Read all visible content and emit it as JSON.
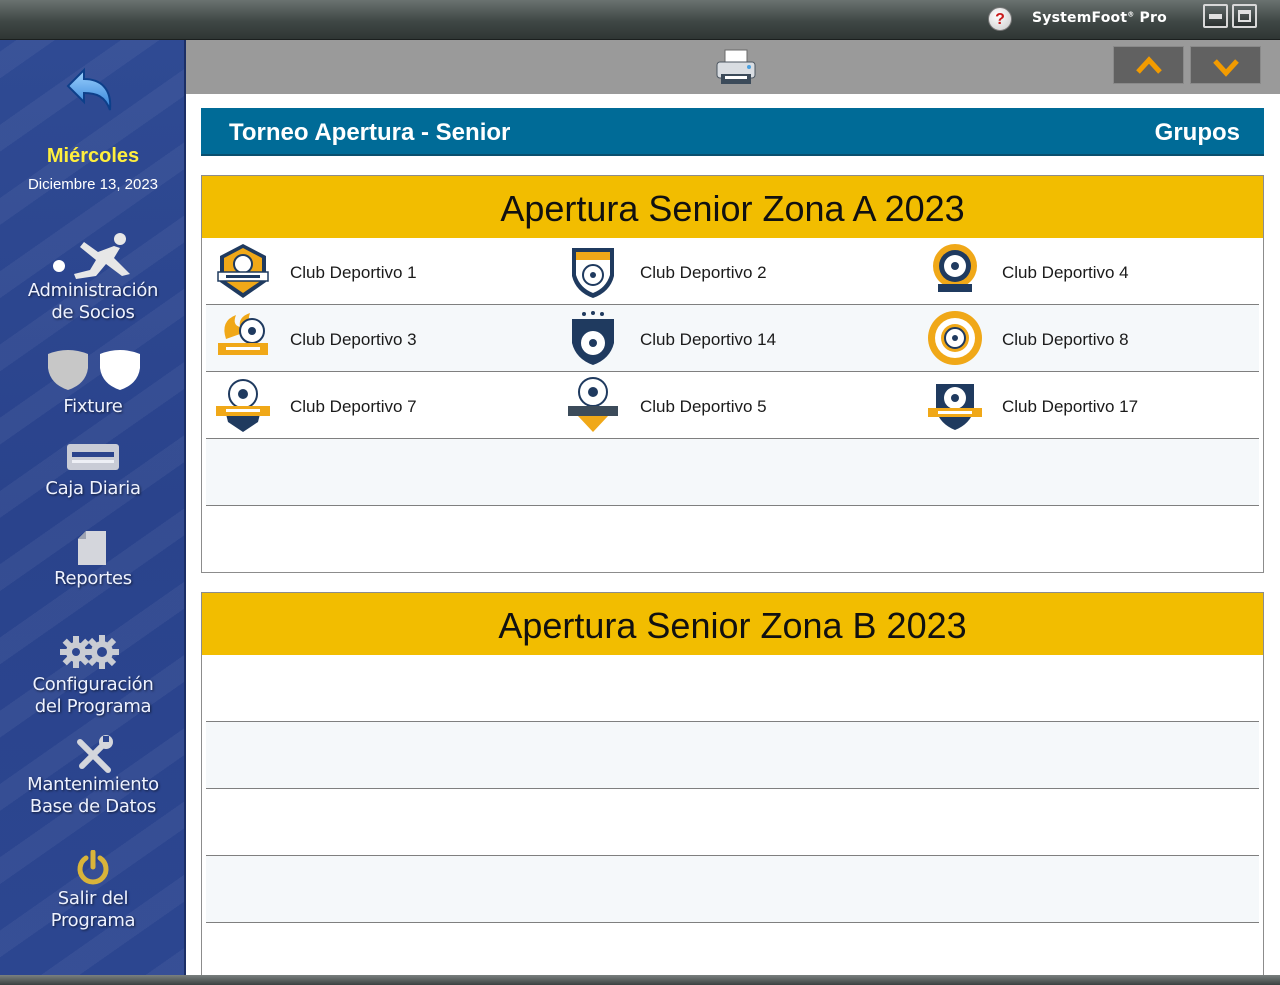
{
  "titlebar": {
    "help_label": "?",
    "brand_name": "SystemFoot",
    "brand_mark": "®",
    "brand_suffix": " Pro"
  },
  "sidebar": {
    "day": "Miércoles",
    "date": "Diciembre 13, 2023",
    "items": [
      {
        "icon": "back-arrow-icon"
      },
      {
        "icon": "soccer-player-icon",
        "line1": "Administración",
        "line2": "de Socios"
      },
      {
        "icon": "shields-icon",
        "line1": "Fixture"
      },
      {
        "icon": "cash-register-icon",
        "line1": "Caja Diaria"
      },
      {
        "icon": "report-icon",
        "line1": "Reportes"
      },
      {
        "icon": "gears-icon",
        "line1": "Configuración",
        "line2": "del Programa"
      },
      {
        "icon": "tools-icon",
        "line1": "Mantenimiento",
        "line2": "Base de Datos"
      },
      {
        "icon": "power-icon",
        "line1": "Salir del",
        "line2": "Programa"
      }
    ]
  },
  "toolbar": {
    "print_icon": "printer-icon",
    "up_icon": "chevron-up-icon",
    "down_icon": "chevron-down-icon"
  },
  "header": {
    "tournament": "Torneo Apertura - Senior",
    "section": "Grupos"
  },
  "zones": [
    {
      "title": "Apertura Senior Zona A 2023",
      "rows": [
        [
          "Club Deportivo 1",
          "Club Deportivo 2",
          "Club Deportivo 4"
        ],
        [
          "Club Deportivo 3",
          "Club Deportivo 14",
          "Club Deportivo 8"
        ],
        [
          "Club Deportivo 7",
          "Club Deportivo 5",
          "Club Deportivo 17"
        ]
      ],
      "empty_rows": 2
    },
    {
      "title": "Apertura Senior Zona B 2023",
      "rows": [],
      "empty_rows": 5
    }
  ],
  "colors": {
    "sidebar": "#2c4690",
    "header_bar": "#006b97",
    "zone_header": "#f2bd00",
    "day_label": "#ffef3d",
    "arrow": "#f29b00"
  }
}
